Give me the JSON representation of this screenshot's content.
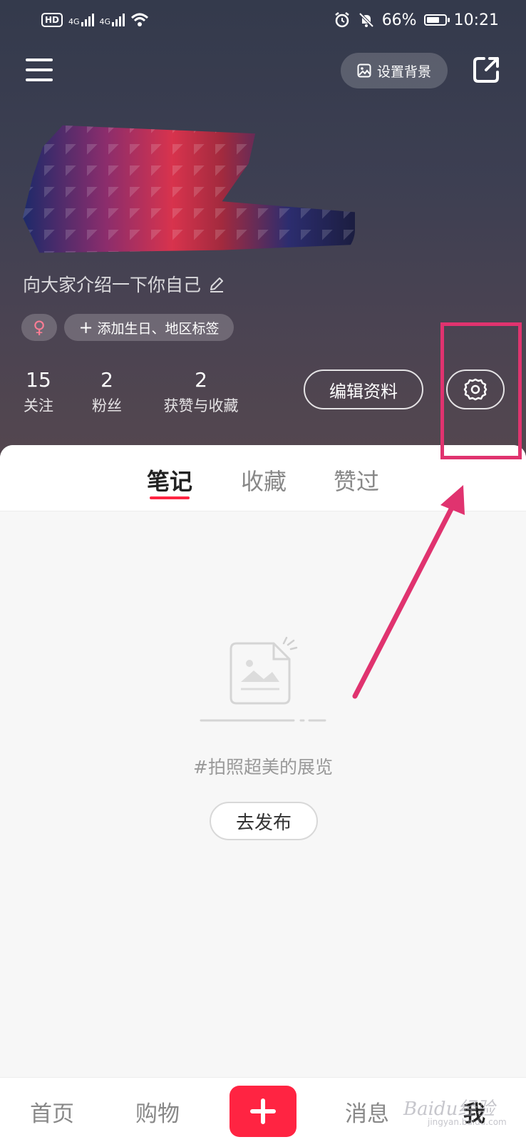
{
  "status_bar": {
    "hd": "HD",
    "sim1": "4G",
    "sim2": "4G",
    "battery": "66%",
    "time": "10:21"
  },
  "header": {
    "set_background_label": "设置背景",
    "intro": "向大家介绍一下你自己",
    "gender_symbol": "♀",
    "add_tags_label": "添加生日、地区标签",
    "stats": [
      {
        "value": "15",
        "label": "关注"
      },
      {
        "value": "2",
        "label": "粉丝"
      },
      {
        "value": "2",
        "label": "获赞与收藏"
      }
    ],
    "edit_profile_label": "编辑资料"
  },
  "tabs": [
    {
      "label": "笔记",
      "active": true
    },
    {
      "label": "收藏",
      "active": false
    },
    {
      "label": "赞过",
      "active": false
    }
  ],
  "empty_state": {
    "text": "#拍照超美的展览",
    "publish_label": "去发布"
  },
  "bottom_nav": [
    {
      "label": "首页"
    },
    {
      "label": "购物"
    },
    {
      "label": "消息"
    },
    {
      "label": "我",
      "active": true
    }
  ],
  "watermark": {
    "text": "Baidu经验",
    "sub": "jingyan.baidu.com"
  },
  "colors": {
    "accent": "#ff2442",
    "annotation": "#e0336f"
  }
}
